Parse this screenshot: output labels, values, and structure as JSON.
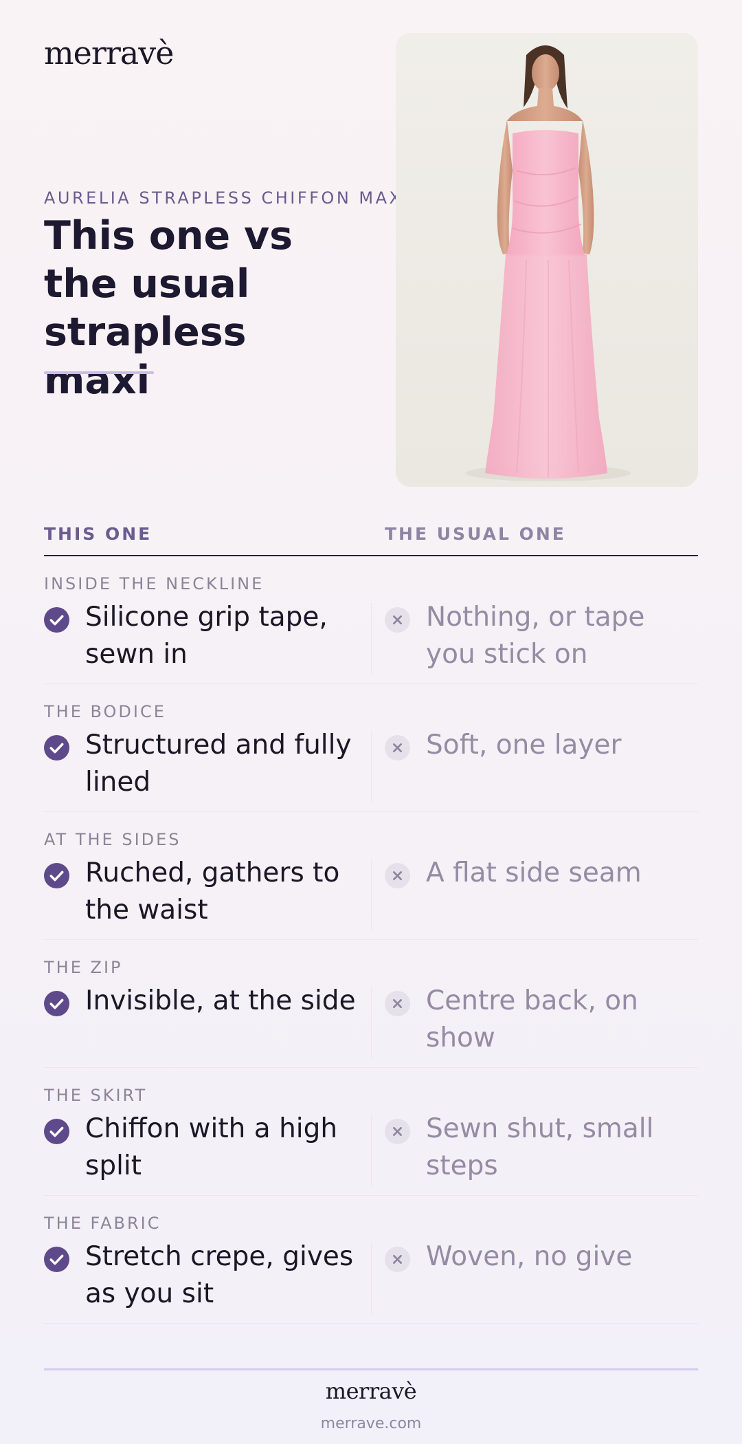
{
  "brand": {
    "logo": "merravè",
    "url": "merrave.com"
  },
  "hero": {
    "eyebrow": "AURELIA STRAPLESS CHIFFON MAXI",
    "headline": "This one vs the usual strapless maxi"
  },
  "table": {
    "col_this": "THIS ONE",
    "col_usual": "THE USUAL ONE",
    "rows": [
      {
        "label": "INSIDE THE NECKLINE",
        "this": "Silicone grip tape, sewn in",
        "usual": "Nothing, or tape you stick on"
      },
      {
        "label": "THE BODICE",
        "this": "Structured and fully lined",
        "usual": "Soft, one layer"
      },
      {
        "label": "AT THE SIDES",
        "this": "Ruched, gathers to the waist",
        "usual": "A flat side seam"
      },
      {
        "label": "THE ZIP",
        "this": "Invisible, at the side",
        "usual": "Centre back, on show"
      },
      {
        "label": "THE SKIRT",
        "this": "Chiffon with a high split",
        "usual": "Sewn shut, small steps"
      },
      {
        "label": "THE FABRIC",
        "this": "Stretch crepe, gives as you sit",
        "usual": "Woven, no give"
      }
    ]
  },
  "colors": {
    "accent": "#5e4a8a",
    "dress": "#f7b8cc",
    "muted": "#938ca4"
  },
  "icons": {
    "this": "check-circle-icon",
    "usual": "x-circle-icon"
  }
}
